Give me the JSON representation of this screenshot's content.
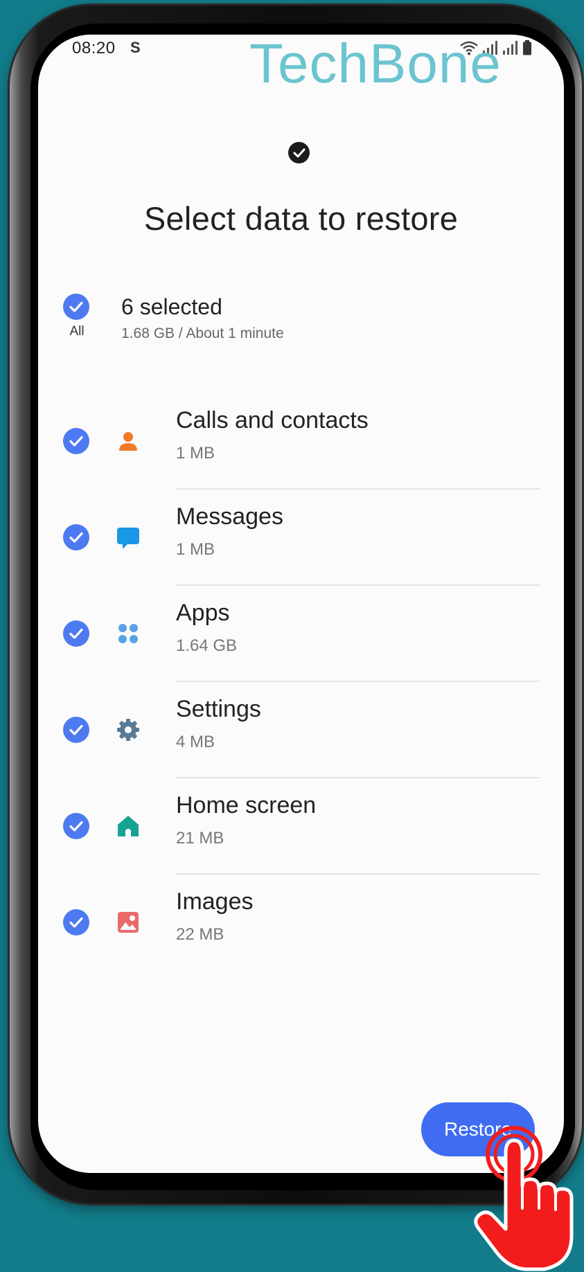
{
  "status_bar": {
    "time": "08:20",
    "s_glyph": "S"
  },
  "watermark": "TechBone",
  "page_title": "Select data to restore",
  "select_all": {
    "label": "All",
    "title": "6 selected",
    "subtitle": "1.68 GB / About 1 minute"
  },
  "items": [
    {
      "name": "Calls and contacts",
      "size": "1 MB",
      "icon": "contact-icon",
      "color": "#f07a2a"
    },
    {
      "name": "Messages",
      "size": "1 MB",
      "icon": "message-icon",
      "color": "#1a97e6"
    },
    {
      "name": "Apps",
      "size": "1.64 GB",
      "icon": "apps-icon",
      "color": "#5aa2e8"
    },
    {
      "name": "Settings",
      "size": "4 MB",
      "icon": "gear-icon",
      "color": "#577a96"
    },
    {
      "name": "Home screen",
      "size": "21 MB",
      "icon": "home-icon",
      "color": "#17a392"
    },
    {
      "name": "Images",
      "size": "22 MB",
      "icon": "image-icon",
      "color": "#ea6a6a"
    }
  ],
  "restore_button": "Restore",
  "colors": {
    "accent": "#3f6cf0",
    "check": "#4d7af0",
    "background": "#127c8a",
    "hand": "#f21c1c"
  }
}
